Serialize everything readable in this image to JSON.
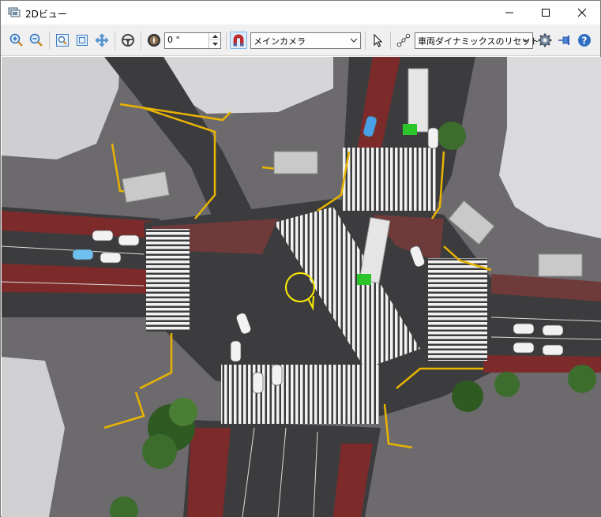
{
  "window": {
    "title": "2Dビュー",
    "app_icon": "layers-icon",
    "controls": {
      "minimize": "minimize-icon",
      "maximize": "maximize-icon",
      "close": "close-icon"
    }
  },
  "toolbar": {
    "buttons": [
      {
        "id": "zoom-in",
        "icon": "zoom-in-icon"
      },
      {
        "id": "zoom-out",
        "icon": "zoom-out-icon"
      },
      {
        "id": "zoom-area",
        "icon": "zoom-area-icon"
      },
      {
        "id": "fit",
        "icon": "fit-window-icon"
      },
      {
        "id": "pan",
        "icon": "pan-icon"
      },
      {
        "id": "steering",
        "icon": "steering-wheel-icon"
      },
      {
        "id": "compass",
        "icon": "compass-icon"
      },
      {
        "id": "magnet",
        "icon": "magnet-icon"
      },
      {
        "id": "select",
        "icon": "cursor-icon"
      },
      {
        "id": "path",
        "icon": "path-icon"
      },
      {
        "id": "settings",
        "icon": "gear-icon"
      },
      {
        "id": "pin",
        "icon": "pin-icon"
      },
      {
        "id": "help",
        "icon": "help-icon"
      }
    ],
    "rotation_value": "0 °",
    "camera_select": "メインカメラ",
    "dynamics_select": "車両ダイナミックスのリセット"
  },
  "colors": {
    "road": "#3c3c3e",
    "sidewalk": "#6d6a6e",
    "bus_lane": "#8f2a2a",
    "crosswalk": "#f2f2f2",
    "curb": "#e8b400",
    "building": "#d8d8d8",
    "selection": "#ffee00"
  }
}
